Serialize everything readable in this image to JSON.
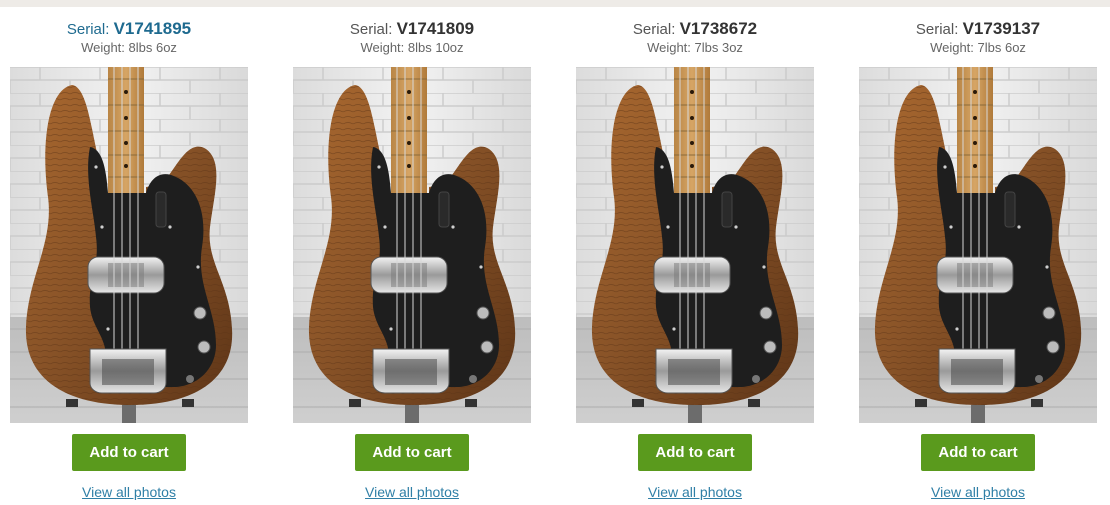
{
  "products": [
    {
      "serial_label": "Serial:",
      "serial": "V1741895",
      "weight": "Weight: 8lbs 6oz",
      "cart_label": "Add to cart",
      "photos_label": "View all photos",
      "image": "bass-guitar-photo"
    },
    {
      "serial_label": "Serial:",
      "serial": "V1741809",
      "weight": "Weight: 8lbs 10oz",
      "cart_label": "Add to cart",
      "photos_label": "View all photos",
      "image": "bass-guitar-photo"
    },
    {
      "serial_label": "Serial:",
      "serial": "V1738672",
      "weight": "Weight: 7lbs 3oz",
      "cart_label": "Add to cart",
      "photos_label": "View all photos",
      "image": "bass-guitar-photo"
    },
    {
      "serial_label": "Serial:",
      "serial": "V1739137",
      "weight": "Weight: 7lbs 6oz",
      "cart_label": "Add to cart",
      "photos_label": "View all photos",
      "image": "bass-guitar-photo"
    }
  ],
  "colors": {
    "accent_link": "#2f7fa6",
    "active_serial": "#1e6a8f",
    "cart_button": "#5a9a1d",
    "body_wood": "#8a5428",
    "pickguard": "#1e1e1e"
  }
}
